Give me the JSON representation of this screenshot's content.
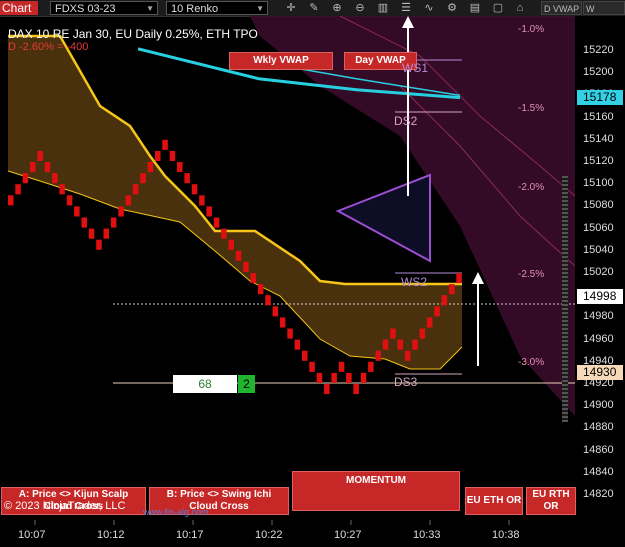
{
  "toolbar": {
    "chart_label": "Chart",
    "instrument": "FDXS 03-23",
    "chart_type": "10 Renko",
    "tabs": [
      "D VWAP",
      "W VWAP"
    ],
    "icons": [
      "crosshair-icon",
      "pencil-icon",
      "zoom-in-icon",
      "zoom-out-icon",
      "bar-chart-icon",
      "properties-icon",
      "indicators-icon",
      "strategies-icon",
      "templates-icon",
      "window-icon",
      "lock-icon"
    ]
  },
  "info": {
    "line1": "DAX 10  RE Jan 30, EU Daily 0.25%, ETH TPO",
    "delta": "D -2.60% = -400"
  },
  "vwap_buttons": {
    "weekly": "Wkly VWAP",
    "daily": "Day VWAP"
  },
  "levels": {
    "ws1": "WS1",
    "ds2": "DS2",
    "ws2": "WS2",
    "ds3": "DS3"
  },
  "percent_labels": [
    {
      "text": "-1.0%",
      "price": 15239
    },
    {
      "text": "-1.5%",
      "price": 15168
    },
    {
      "text": "-2.0%",
      "price": 15097
    },
    {
      "text": "-2.5%",
      "price": 15018
    },
    {
      "text": "-3.0%",
      "price": 14939
    }
  ],
  "price_axis": {
    "ticks": [
      "15220",
      "15200",
      "15180",
      "15160",
      "15140",
      "15120",
      "15100",
      "15080",
      "15060",
      "15040",
      "15020",
      "15000",
      "14980",
      "14960",
      "14940",
      "14920",
      "14900",
      "14880",
      "14860",
      "14840",
      "14820"
    ],
    "current_price": "15178",
    "last_price": "14998",
    "level_price": "14930",
    "colors": {
      "current": "#33d1e6",
      "last": "#ffffff",
      "level": "#f5d9b8"
    }
  },
  "time_axis": {
    "ticks": [
      "10:07",
      "10:12",
      "10:17",
      "10:22",
      "10:27",
      "10:33",
      "10:38"
    ]
  },
  "counter": {
    "value": "68",
    "badge": "2"
  },
  "buttons": {
    "kijun": "A: Price <> Kijun Scalp",
    "kijun_sub": "Cloud Cross",
    "ichi": "B: Price <> Swing Ichi",
    "ichi_sub": "Cloud Cross",
    "momentum": "MOMENTUM",
    "eu_eth": "EU ETH OR",
    "eu_rth": "EU RTH",
    "eu_rth_sub": "OR"
  },
  "footer": {
    "copyright": "© 2023 NinjaTrader, LLC",
    "website": "www.fin-alg.com"
  },
  "colors": {
    "bar": "#e01010",
    "cloud_line": "#f5c518",
    "cloud_fill": "#5b3d12",
    "vwap": "#27d0e0",
    "band": "#3a0c2a",
    "triangle": "#9c4fd3"
  },
  "chart_data": {
    "type": "renko",
    "brick_size": 10,
    "price_range": [
      14810,
      15235
    ],
    "time_ticks": [
      "10:07",
      "10:12",
      "10:17",
      "10:22",
      "10:27",
      "10:33",
      "10:38"
    ],
    "bricks": [
      15080,
      15090,
      15100,
      15110,
      15120,
      15110,
      15100,
      15090,
      15080,
      15070,
      15060,
      15050,
      15040,
      15050,
      15060,
      15070,
      15080,
      15090,
      15100,
      15110,
      15120,
      15130,
      15120,
      15110,
      15100,
      15090,
      15080,
      15070,
      15060,
      15050,
      15040,
      15030,
      15020,
      15010,
      15000,
      14990,
      14980,
      14970,
      14960,
      14950,
      14940,
      14930,
      14920,
      14910,
      14920,
      14930,
      14920,
      14910,
      14920,
      14930,
      14940,
      14950,
      14960,
      14950,
      14940,
      14950,
      14960,
      14970,
      14980,
      14990,
      15000,
      15010
    ],
    "series": [
      {
        "name": "Wkly VWAP",
        "x": [
          0.24,
          0.45,
          0.62,
          0.8
        ],
        "values": [
          15222,
          15195,
          15185,
          15178
        ]
      },
      {
        "name": "Day VWAP",
        "x": [
          0.4,
          0.62,
          0.8
        ],
        "values": [
          15215,
          15195,
          15180
        ]
      }
    ]
  }
}
